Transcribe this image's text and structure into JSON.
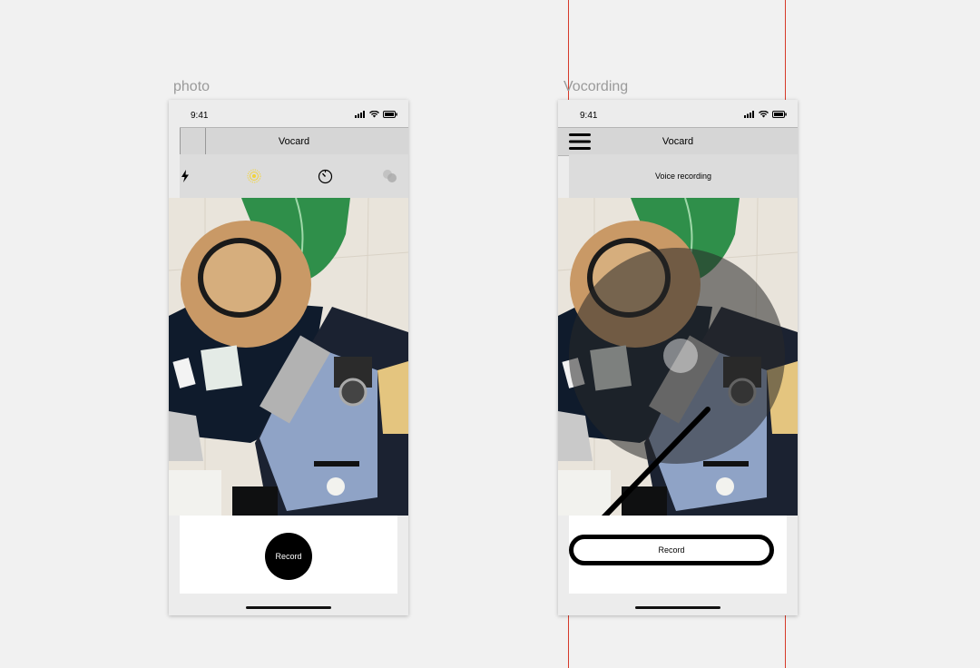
{
  "artboards": {
    "photo": {
      "title": "photo",
      "status": {
        "time": "9:41"
      },
      "nav": {
        "title": "Vocard"
      },
      "toolbar": {
        "icons": [
          "flash-icon",
          "live-photo-icon",
          "timer-icon",
          "filters-icon"
        ],
        "active_color": "#f2d33a"
      },
      "record_label": "Record"
    },
    "recording": {
      "title": "Vocording",
      "status": {
        "time": "9:41"
      },
      "nav": {
        "title": "Vocard"
      },
      "subtitle": "Voice recording",
      "record_label": "Record"
    }
  },
  "colors": {
    "guide": "#d63a2a",
    "nav_bg": "#d6d6d6",
    "toolbar_bg": "#dcdcdc",
    "canvas": "#f1f1f1"
  }
}
